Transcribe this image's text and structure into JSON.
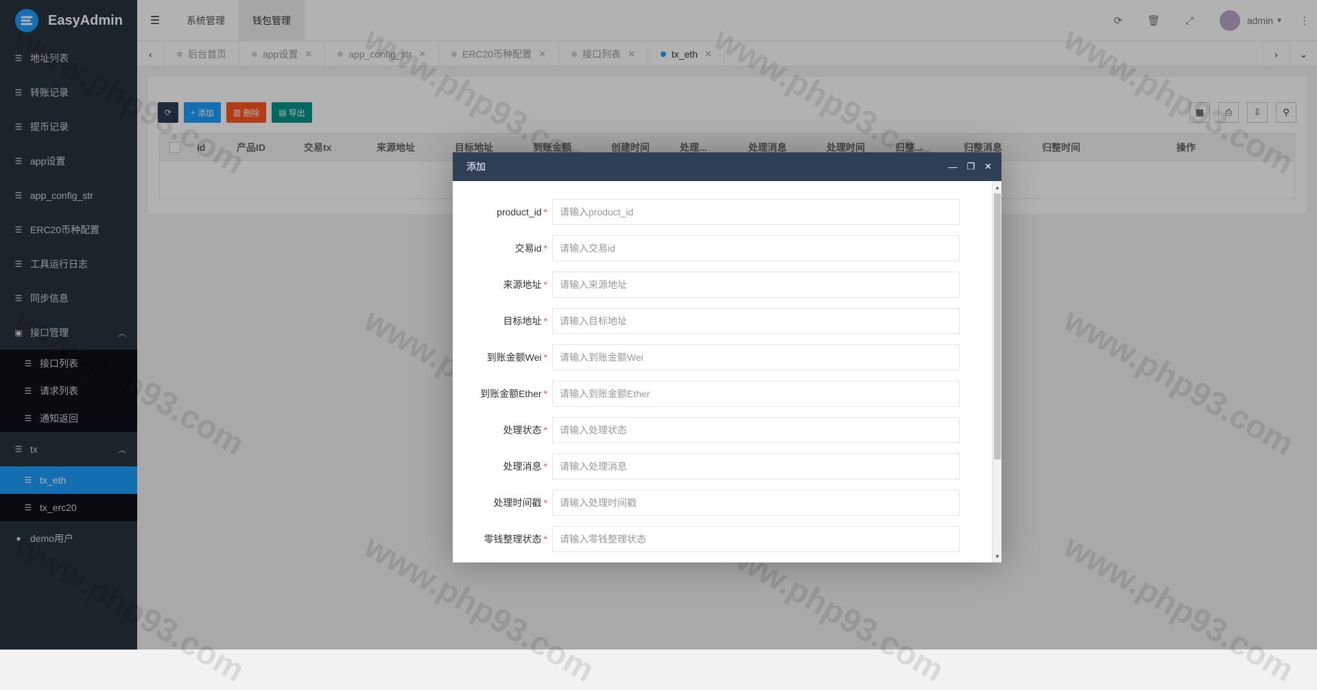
{
  "brand": {
    "name": "EasyAdmin"
  },
  "sidebar": {
    "items": [
      {
        "label": "地址列表"
      },
      {
        "label": "转账记录"
      },
      {
        "label": "提币记录"
      },
      {
        "label": "app设置"
      },
      {
        "label": "app_config_str"
      },
      {
        "label": "ERC20币种配置"
      },
      {
        "label": "工具运行日志"
      },
      {
        "label": "同步信息"
      },
      {
        "label": "接口管理"
      },
      {
        "label": "tx"
      },
      {
        "label": "demo用户"
      }
    ],
    "api_sub": [
      {
        "label": "接口列表"
      },
      {
        "label": "请求列表"
      },
      {
        "label": "通知返回"
      }
    ],
    "tx_sub": [
      {
        "label": "tx_eth"
      },
      {
        "label": "tx_erc20"
      }
    ]
  },
  "header": {
    "nav": [
      {
        "label": "系统管理"
      },
      {
        "label": "钱包管理"
      }
    ],
    "user": "admin"
  },
  "tabs": [
    {
      "label": "后台首页"
    },
    {
      "label": "app设置"
    },
    {
      "label": "app_config_str"
    },
    {
      "label": "ERC20币种配置"
    },
    {
      "label": "接口列表"
    },
    {
      "label": "tx_eth"
    }
  ],
  "toolbar": {
    "add": "添加",
    "delete": "删除",
    "export": "导出"
  },
  "table": {
    "columns": [
      "id",
      "产品ID",
      "交易tx",
      "来源地址",
      "目标地址",
      "到账金额",
      "创建时间",
      "处理...",
      "处理消息",
      "处理时间",
      "归整...",
      "归整消息",
      "归整时间",
      "操作"
    ]
  },
  "modal": {
    "title": "添加",
    "fields": [
      {
        "label": "product_id",
        "placeholder": "请输入product_id"
      },
      {
        "label": "交易id",
        "placeholder": "请输入交易id"
      },
      {
        "label": "来源地址",
        "placeholder": "请输入来源地址"
      },
      {
        "label": "目标地址",
        "placeholder": "请输入目标地址"
      },
      {
        "label": "到账金额Wei",
        "placeholder": "请输入到账金额Wei"
      },
      {
        "label": "到账金额Ether",
        "placeholder": "请输入到账金额Ether"
      },
      {
        "label": "处理状态",
        "placeholder": "请输入处理状态"
      },
      {
        "label": "处理消息",
        "placeholder": "请输入处理消息"
      },
      {
        "label": "处理时间戳",
        "placeholder": "请输入处理时间戳"
      },
      {
        "label": "零钱整理状态",
        "placeholder": "请输入零钱整理状态"
      }
    ],
    "required_mark": "*"
  },
  "watermark": "www.php93.com",
  "colors": {
    "accent": "#1e9fff",
    "sidebar_bg": "#28333e",
    "modal_head": "#2f4056"
  }
}
